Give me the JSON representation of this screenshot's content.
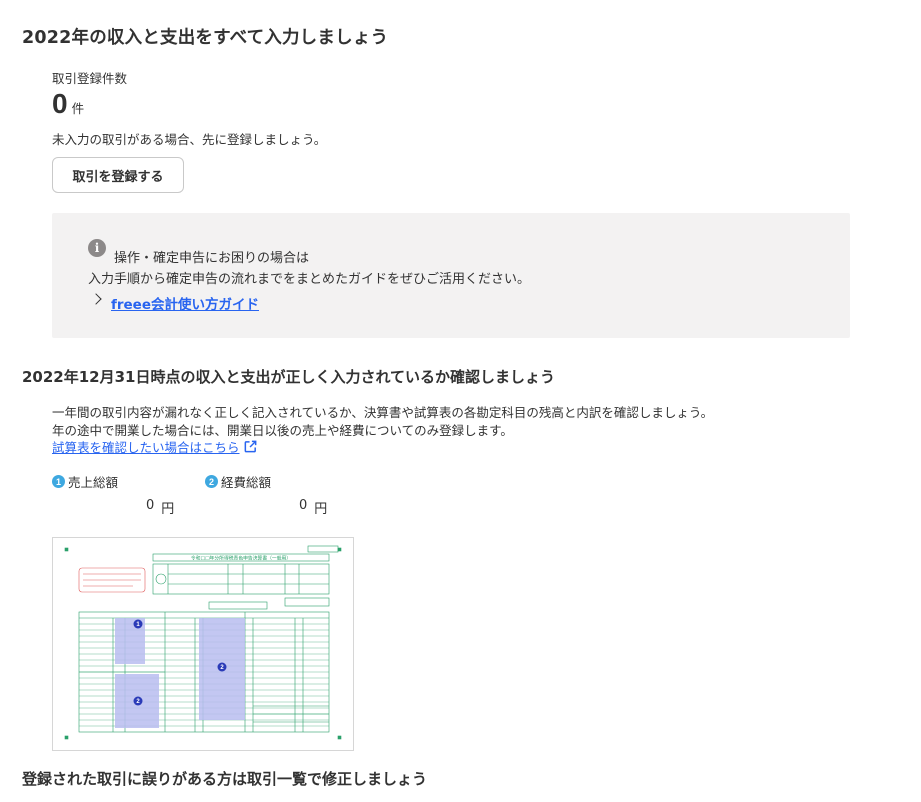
{
  "income_section": {
    "title": "2022年の収入と支出をすべて入力しましょう",
    "count_label": "取引登録件数",
    "count_value": "0",
    "count_unit": "件",
    "unregistered_note": "未入力の取引がある場合、先に登録しましょう。",
    "register_button": "取引を登録する"
  },
  "help_box": {
    "icon": "info-icon",
    "title": "操作・確定申告にお困りの場合は",
    "description": "入力手順から確定申告の流れまでをまとめたガイドをぜひご活用ください。",
    "link": "freee会計使い方ガイド"
  },
  "confirm_section": {
    "title": "2022年12月31日時点の収入と支出が正しく入力されているか確認しましょう",
    "desc_line1": "一年間の取引内容が漏れなく正しく記入されているか、決算書や試算表の各勘定科目の残高と内訳を確認しましょう。",
    "desc_line2": "年の途中で開業した場合には、開業日以後の売上や経費についてのみ登録します。",
    "trial_balance_link": "試算表を確認したい場合はこちら",
    "metrics": [
      {
        "badge": "1",
        "label": "売上総額",
        "value": "0",
        "unit": "円"
      },
      {
        "badge": "2",
        "label": "経費総額",
        "value": "0",
        "unit": "円"
      }
    ],
    "form_image": {
      "title": "令和□□年分所得税青色申告決算書（一般用）",
      "markers": [
        "1",
        "2",
        "2"
      ]
    }
  },
  "correction_section": {
    "title": "登録された取引に誤りがある方は取引一覧で修正しましょう"
  },
  "colors": {
    "text": "#323232",
    "link": "#2864f0",
    "help_bg": "#f3f2f2",
    "badge": "#3ea8e0",
    "form_green": "#2aa06a",
    "form_highlight": "#b9bdf0",
    "form_marker": "#2b3bb8"
  }
}
